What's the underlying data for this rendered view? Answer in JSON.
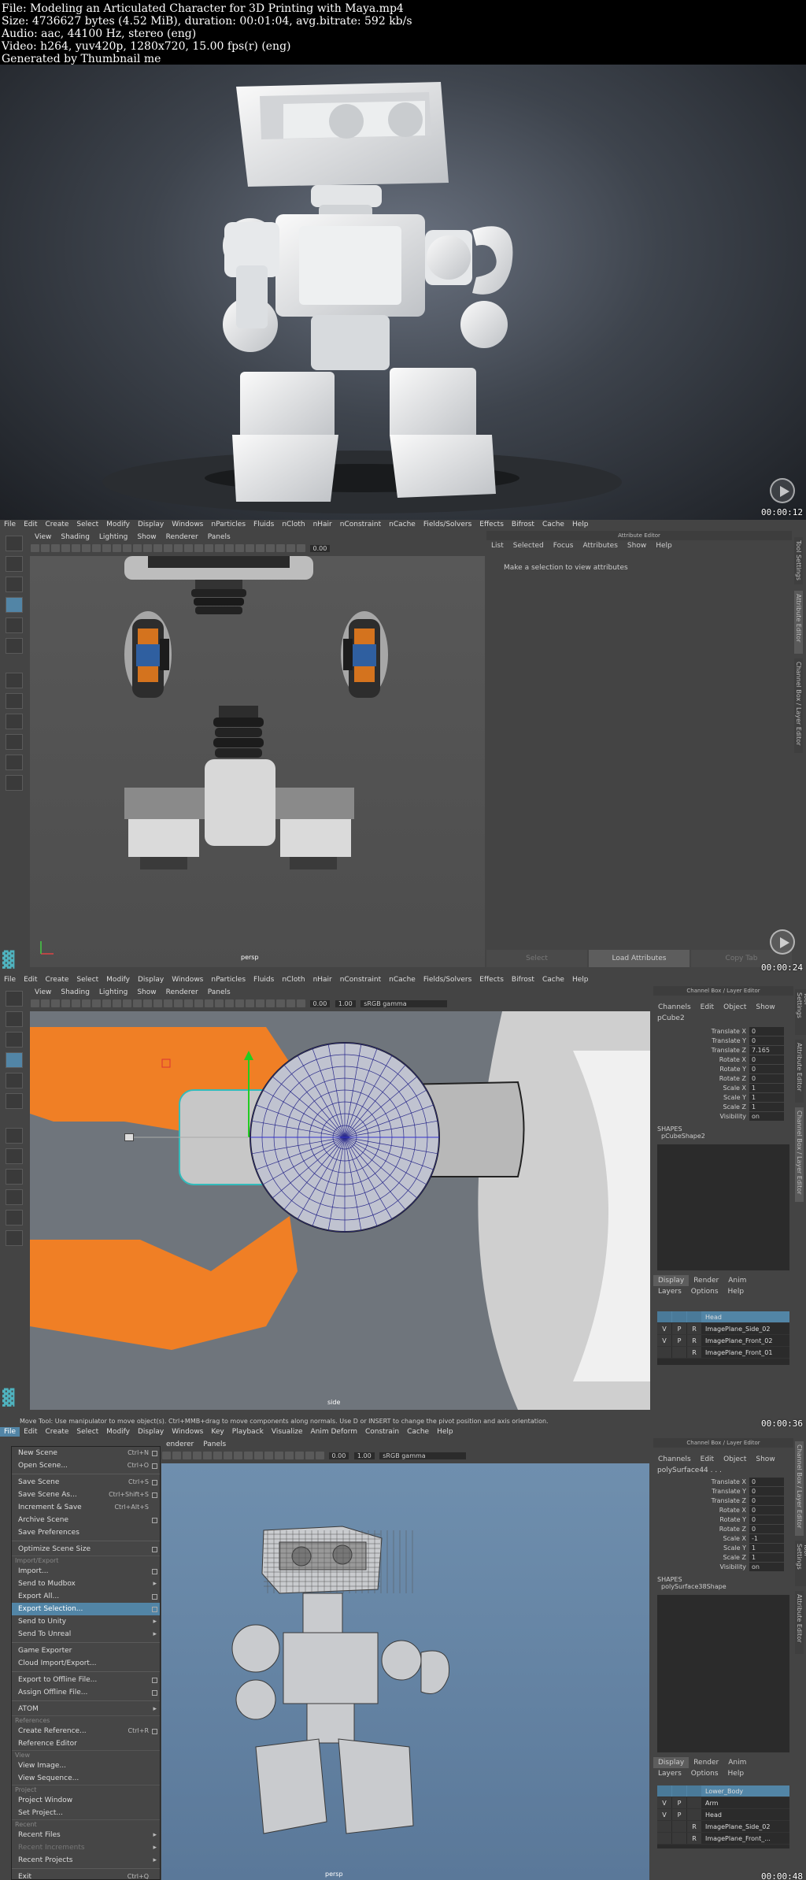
{
  "info": {
    "line1": "File: Modeling an Articulated Character for 3D Printing with Maya.mp4",
    "line2": "Size: 4736627 bytes (4.52 MiB), duration: 00:01:04, avg.bitrate: 592 kb/s",
    "line3": "Audio: aac, 44100 Hz, stereo (eng)",
    "line4": "Video: h264, yuv420p, 1280x720, 15.00 fps(r) (eng)",
    "line5": "Generated by Thumbnail me"
  },
  "timestamps": [
    "00:00:12",
    "00:00:24",
    "00:00:36",
    "00:00:48"
  ],
  "maya": {
    "menu_f2": [
      "File",
      "Edit",
      "Create",
      "Select",
      "Modify",
      "Display",
      "Windows",
      "nParticles",
      "Fluids",
      "nCloth",
      "nHair",
      "nConstraint",
      "nCache",
      "Fields/Solvers",
      "Effects",
      "Bifrost",
      "Cache",
      "Help"
    ],
    "menu_f4": [
      "File",
      "Edit",
      "Create",
      "Select",
      "Modify",
      "Display",
      "Windows",
      "Key",
      "Playback",
      "Visualize",
      "Anim Deform",
      "Constrain",
      "Cache",
      "Help"
    ],
    "panel_menu": [
      "View",
      "Shading",
      "Lighting",
      "Show",
      "Renderer",
      "Panels"
    ],
    "panel_menu_f4": [
      "enderer",
      "Panels"
    ],
    "field_val1": "0.00",
    "field_val2": "1.00",
    "gamma": "sRGB gamma",
    "attr_editor": {
      "title": "Attribute Editor",
      "tabs": [
        "List",
        "Selected",
        "Focus",
        "Attributes",
        "Show",
        "Help"
      ],
      "msg": "Make a selection to view attributes",
      "btn_select": "Select",
      "btn_load": "Load Attributes",
      "btn_copy": "Copy Tab"
    },
    "side_tabs_f2": [
      "Tool Settings",
      "Attribute Editor",
      "Channel Box / Layer Editor"
    ],
    "side_tabs_f3": [
      "Tool Settings",
      "Attribute Editor",
      "Channel Box / Layer Editor"
    ],
    "side_tabs_f4": [
      "Channel Box / Layer Editor",
      "Tool Settings",
      "Attribute Editor"
    ],
    "viewport_label_persp": "persp",
    "viewport_label_side": "side",
    "channel_box": {
      "title": "Channel Box / Layer Editor",
      "tabs": [
        "Channels",
        "Edit",
        "Object",
        "Show"
      ],
      "object_f3": "pCube2",
      "object_f4": "polySurface44 . . .",
      "attrs": [
        "Translate X",
        "Translate Y",
        "Translate Z",
        "Rotate X",
        "Rotate Y",
        "Rotate Z",
        "Scale X",
        "Scale Y",
        "Scale Z",
        "Visibility"
      ],
      "values_f3": [
        "0",
        "0",
        "7.165",
        "0",
        "0",
        "0",
        "1",
        "1",
        "1",
        "on"
      ],
      "values_f4": [
        "0",
        "0",
        "0",
        "0",
        "0",
        "0",
        "-1",
        "1",
        "1",
        "on"
      ],
      "shapes_label": "SHAPES",
      "shape_f3": "pCubeShape2",
      "shape_f4": "polySurface38Shape"
    },
    "layer_editor": {
      "tabs": [
        "Display",
        "Render",
        "Anim"
      ],
      "menu": [
        "Layers",
        "Options",
        "Help"
      ],
      "layers_f3": [
        {
          "v": "",
          "p": "",
          "r": "",
          "name": "Head",
          "sel": true
        },
        {
          "v": "V",
          "p": "P",
          "r": "R",
          "name": "ImagePlane_Side_02",
          "sel": false
        },
        {
          "v": "V",
          "p": "P",
          "r": "R",
          "name": "ImagePlane_Front_02",
          "sel": false
        },
        {
          "v": "",
          "p": "",
          "r": "R",
          "name": "ImagePlane_Front_01",
          "sel": false
        }
      ],
      "layers_f4": [
        {
          "v": "",
          "p": "",
          "r": "",
          "name": "Lower_Body",
          "sel": true
        },
        {
          "v": "V",
          "p": "P",
          "r": "",
          "name": "Arm",
          "sel": false
        },
        {
          "v": "V",
          "p": "P",
          "r": "",
          "name": "Head",
          "sel": false
        },
        {
          "v": "",
          "p": "",
          "r": "R",
          "name": "ImagePlane_Side_02",
          "sel": false
        },
        {
          "v": "",
          "p": "",
          "r": "R",
          "name": "ImagePlane_Front_...",
          "sel": false
        }
      ]
    },
    "status_f3": "Move Tool: Use manipulator to move object(s). Ctrl+MMB+drag to move components along normals. Use D or INSERT to change the pivot position and axis orientation."
  },
  "file_menu": [
    {
      "label": "New Scene",
      "sc": "Ctrl+N",
      "box": true
    },
    {
      "label": "Open Scene...",
      "sc": "Ctrl+O",
      "box": true
    },
    {
      "sep": true
    },
    {
      "label": "Save Scene",
      "sc": "Ctrl+S",
      "box": true
    },
    {
      "label": "Save Scene As...",
      "sc": "Ctrl+Shift+S",
      "box": true
    },
    {
      "label": "Increment & Save",
      "sc": "Ctrl+Alt+S",
      "box": false
    },
    {
      "label": "Archive Scene",
      "sc": "",
      "box": true
    },
    {
      "label": "Save Preferences",
      "sc": "",
      "box": false
    },
    {
      "sep": true
    },
    {
      "label": "Optimize Scene Size",
      "sc": "",
      "box": true
    },
    {
      "section": "Import/Export"
    },
    {
      "label": "Import...",
      "sc": "",
      "box": true
    },
    {
      "label": "Send to Mudbox",
      "sc": "",
      "arrow": true
    },
    {
      "label": "Export All...",
      "sc": "",
      "box": true
    },
    {
      "label": "Export Selection...",
      "sc": "",
      "box": true,
      "hl": true
    },
    {
      "label": "Send to Unity",
      "sc": "",
      "arrow": true
    },
    {
      "label": "Send To Unreal",
      "sc": "",
      "arrow": true
    },
    {
      "sep": true
    },
    {
      "label": "Game Exporter",
      "sc": ""
    },
    {
      "label": "Cloud Import/Export...",
      "sc": ""
    },
    {
      "sep": true
    },
    {
      "label": "Export to Offline File...",
      "sc": "",
      "box": true
    },
    {
      "label": "Assign Offline File...",
      "sc": "",
      "box": true
    },
    {
      "sep": true
    },
    {
      "label": "ATOM",
      "sc": "",
      "arrow": true
    },
    {
      "section": "References"
    },
    {
      "label": "Create Reference...",
      "sc": "Ctrl+R",
      "box": true
    },
    {
      "label": "Reference Editor",
      "sc": ""
    },
    {
      "section": "View"
    },
    {
      "label": "View Image...",
      "sc": ""
    },
    {
      "label": "View Sequence...",
      "sc": ""
    },
    {
      "section": "Project"
    },
    {
      "label": "Project Window",
      "sc": ""
    },
    {
      "label": "Set Project...",
      "sc": ""
    },
    {
      "section": "Recent"
    },
    {
      "label": "Recent Files",
      "sc": "",
      "arrow": true
    },
    {
      "label": "Recent Increments",
      "sc": "",
      "arrow": true,
      "dis": true
    },
    {
      "label": "Recent Projects",
      "sc": "",
      "arrow": true
    },
    {
      "sep": true
    },
    {
      "label": "Exit",
      "sc": "Ctrl+Q"
    }
  ]
}
